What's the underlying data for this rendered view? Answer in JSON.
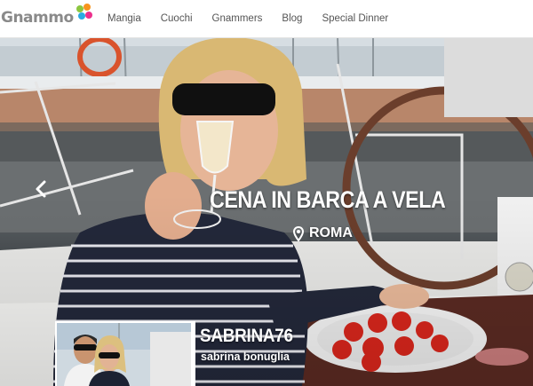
{
  "logo": {
    "text": "Gnammo",
    "dot_colors": [
      "#8cc63f",
      "#f7941d",
      "#29abe2",
      "#ec2f8c"
    ]
  },
  "nav": {
    "items": [
      {
        "label": "Mangia"
      },
      {
        "label": "Cuochi"
      },
      {
        "label": "Gnammers"
      },
      {
        "label": "Blog"
      },
      {
        "label": "Special Dinner"
      }
    ]
  },
  "hero": {
    "prev_icon": "chevron-left-icon",
    "event_title": "CENA IN BARCA A VELA",
    "location_icon": "map-pin-icon",
    "location": "ROMA"
  },
  "host": {
    "display_name": "SABRINA76",
    "username": "sabrina bonuglia"
  },
  "colors": {
    "nav_text": "#555555",
    "hero_text": "#ffffff"
  }
}
